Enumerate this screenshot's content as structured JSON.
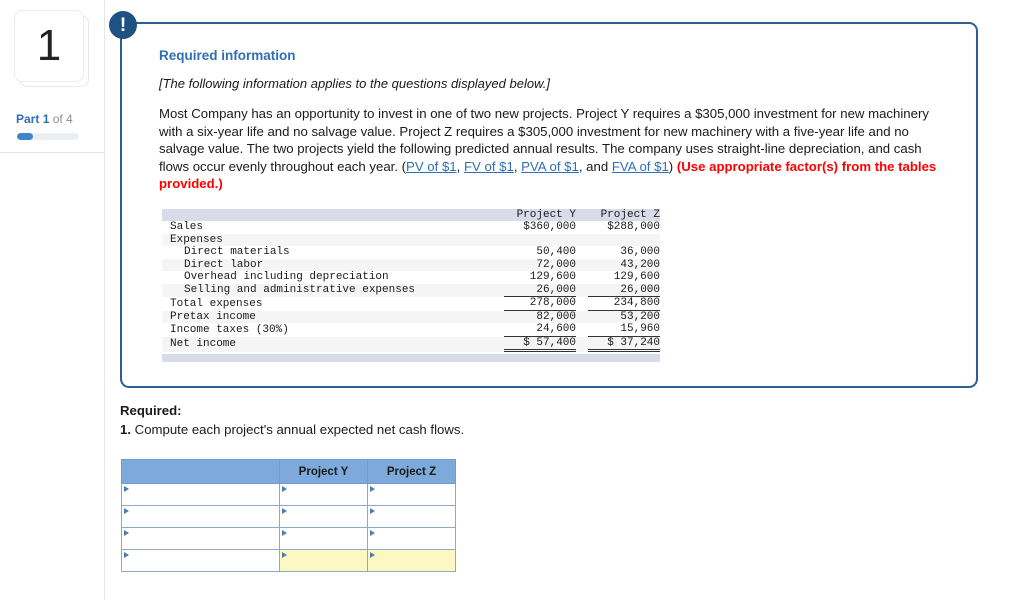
{
  "left_rail": {
    "question_number": "1",
    "part_prefix": "Part",
    "part_current": "1",
    "part_suffix": "of 4",
    "progress_percent": 25
  },
  "info_panel": {
    "badge_icon": "exclamation-icon",
    "heading": "Required information",
    "subheading": "[The following information applies to the questions displayed below.]",
    "body_part_1": "Most Company has an opportunity to invest in one of two new projects. Project Y requires a $305,000 investment for new machinery with a six-year life and no salvage value. Project Z requires a $305,000 investment for new machinery with a five-year life and no salvage value. The two projects yield the following predicted annual results. The company uses straight-line depreciation, and cash flows occur evenly throughout each year. (",
    "link_1": "PV of $1",
    "sep_1": ", ",
    "link_2": "FV of $1",
    "sep_2": ", ",
    "link_3": "PVA of $1",
    "sep_3": ", and ",
    "link_4": "FVA of $1",
    "body_part_2": ")",
    "red_note": "(Use appropriate factor(s) from the tables provided.)"
  },
  "fin_table": {
    "col_headers": [
      "",
      "Project Y",
      "Project Z"
    ],
    "rows": [
      {
        "label": "Sales",
        "y": "$360,000",
        "z": "$288,000",
        "indent": 0,
        "rule": "none"
      },
      {
        "label": "Expenses",
        "y": "",
        "z": "",
        "indent": 0,
        "rule": "none"
      },
      {
        "label": "Direct materials",
        "y": "50,400",
        "z": "36,000",
        "indent": 1,
        "rule": "none"
      },
      {
        "label": "Direct labor",
        "y": "72,000",
        "z": "43,200",
        "indent": 1,
        "rule": "none"
      },
      {
        "label": "Overhead including depreciation",
        "y": "129,600",
        "z": "129,600",
        "indent": 1,
        "rule": "none"
      },
      {
        "label": "Selling and administrative expenses",
        "y": "26,000",
        "z": "26,000",
        "indent": 1,
        "rule": "single"
      },
      {
        "label": "Total expenses",
        "y": "278,000",
        "z": "234,800",
        "indent": 0,
        "rule": "single"
      },
      {
        "label": "Pretax income",
        "y": "82,000",
        "z": "53,200",
        "indent": 0,
        "rule": "none"
      },
      {
        "label": "Income taxes (30%)",
        "y": "24,600",
        "z": "15,960",
        "indent": 0,
        "rule": "single"
      },
      {
        "label": "Net income",
        "y": "$ 57,400",
        "z": "$ 37,240",
        "indent": 0,
        "rule": "double"
      }
    ]
  },
  "required_section": {
    "title": "Required:",
    "question_number": "1.",
    "question_text": "Compute each project's annual expected net cash flows."
  },
  "answer_table": {
    "headers": [
      "",
      "Project Y",
      "Project Z"
    ],
    "rows": [
      {
        "label": "",
        "y": "",
        "z": "",
        "highlight": false
      },
      {
        "label": "",
        "y": "",
        "z": "",
        "highlight": false
      },
      {
        "label": "",
        "y": "",
        "z": "",
        "highlight": false
      },
      {
        "label": "",
        "y": "",
        "z": "",
        "highlight": true
      }
    ]
  },
  "colors": {
    "link_blue": "#2f6fb5",
    "panel_border": "#2e5f93",
    "badge_blue": "#1f5282",
    "red_note": "#ff0000",
    "table_band": "#d7dce8",
    "answer_header_blue": "#7daada",
    "answer_highlight_yellow": "#fbf8c4",
    "progress_blue": "#3d85cc"
  }
}
